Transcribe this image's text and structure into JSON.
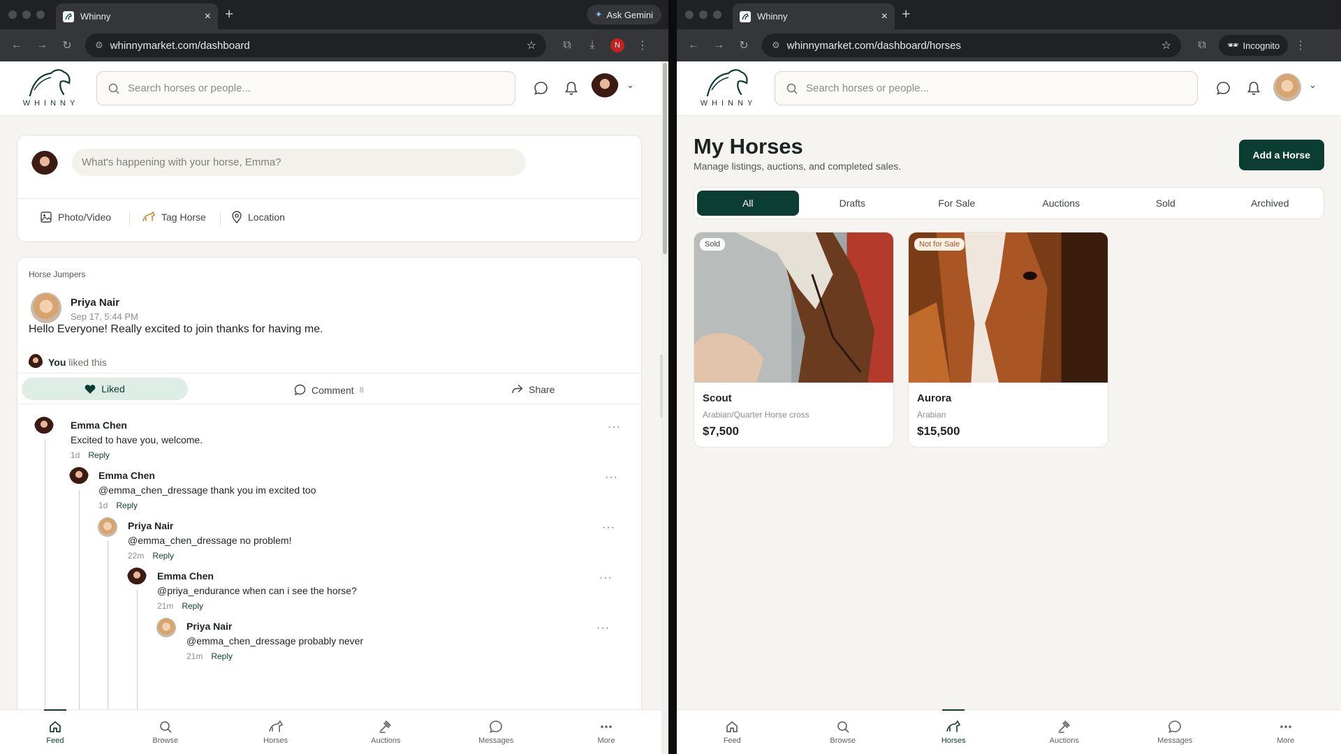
{
  "colors": {
    "brand": "#0b3d32",
    "chrome_dark": "#202124",
    "page_bg": "#f5f4f0"
  },
  "left": {
    "tab_title": "Whinny",
    "ask_gemini": "Ask Gemini",
    "url": "whinnymarket.com/dashboard",
    "profile_initial": "N",
    "logo_text": "WHINNY",
    "search_placeholder": "Search horses or people...",
    "composer": {
      "placeholder": "What's happening with your horse, Emma?",
      "photo": "Photo/Video",
      "tag": "Tag Horse",
      "location": "Location"
    },
    "post": {
      "group": "Horse Jumpers",
      "author": "Priya Nair",
      "date": "Sep 17, 5:44 PM",
      "text": "Hello Everyone! Really excited to join thanks for having me.",
      "liked_by": "You",
      "liked_suffix": "liked this",
      "liked_label": "Liked",
      "comment_label": "Comment",
      "comment_count": "8",
      "share_label": "Share"
    },
    "comments": [
      {
        "name": "Emma Chen",
        "text": "Excited to have you, welcome.",
        "time": "1d",
        "reply": "Reply"
      },
      {
        "name": "Emma Chen",
        "text": "@emma_chen_dressage thank you im excited too",
        "time": "1d",
        "reply": "Reply"
      },
      {
        "name": "Priya Nair",
        "text": "@emma_chen_dressage no problem!",
        "time": "22m",
        "reply": "Reply"
      },
      {
        "name": "Emma Chen",
        "text": "@priya_endurance when can i see the horse?",
        "time": "21m",
        "reply": "Reply"
      },
      {
        "name": "Priya Nair",
        "text": "@emma_chen_dressage probably never",
        "time": "21m",
        "reply": "Reply"
      }
    ],
    "comment_more": "···",
    "bottom_nav": [
      "Feed",
      "Browse",
      "Horses",
      "Auctions",
      "Messages",
      "More"
    ]
  },
  "right": {
    "tab_title": "Whinny",
    "url": "whinnymarket.com/dashboard/horses",
    "incognito": "Incognito",
    "logo_text": "WHINNY",
    "search_placeholder": "Search horses or people...",
    "title": "My Horses",
    "subtitle": "Manage listings, auctions, and completed sales.",
    "add_button": "Add a Horse",
    "tabs": [
      "All",
      "Drafts",
      "For Sale",
      "Auctions",
      "Sold",
      "Archived"
    ],
    "horses": [
      {
        "badge": "Sold",
        "name": "Scout",
        "breed": "Arabian/Quarter Horse cross",
        "price": "$7,500"
      },
      {
        "badge": "Not for Sale",
        "name": "Aurora",
        "breed": "Arabian",
        "price": "$15,500"
      }
    ],
    "bottom_nav": [
      "Feed",
      "Browse",
      "Horses",
      "Auctions",
      "Messages",
      "More"
    ]
  }
}
